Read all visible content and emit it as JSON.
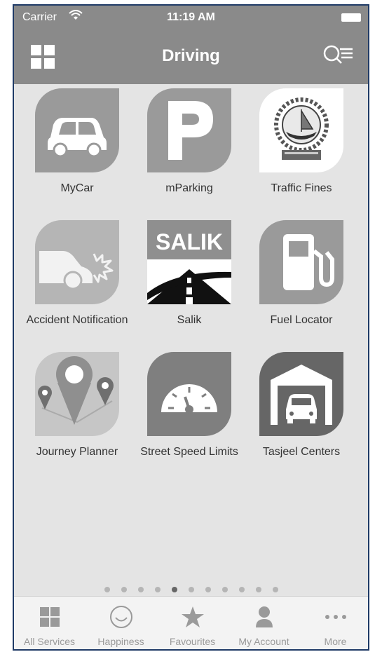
{
  "statusbar": {
    "carrier": "Carrier",
    "time": "11:19 AM"
  },
  "navbar": {
    "title": "Driving"
  },
  "tiles": [
    {
      "label": "MyCar",
      "icon": "car-icon"
    },
    {
      "label": "mParking",
      "icon": "parking-p-icon"
    },
    {
      "label": "Traffic Fines",
      "icon": "dubai-police-emblem"
    },
    {
      "label": "Accident Notification",
      "icon": "accident-car-icon"
    },
    {
      "label": "Salik",
      "icon": "salik-road-icon",
      "logo_text": "SALIK"
    },
    {
      "label": "Fuel Locator",
      "icon": "fuel-pump-icon"
    },
    {
      "label": "Journey Planner",
      "icon": "map-pins-icon"
    },
    {
      "label": "Street Speed Limits",
      "icon": "speedometer-icon"
    },
    {
      "label": "Tasjeel Centers",
      "icon": "garage-car-icon"
    }
  ],
  "pager": {
    "count": 11,
    "active_index": 4
  },
  "tabbar": {
    "all_services": "All Services",
    "happiness": "Happiness",
    "favourites": "Favourites",
    "my_account": "My Account",
    "more": "More"
  },
  "colors": {
    "bar": "#8a8a8a",
    "tile": "#9a9a9a",
    "background": "#e4e4e4",
    "tab_text": "#9a9a9a"
  }
}
